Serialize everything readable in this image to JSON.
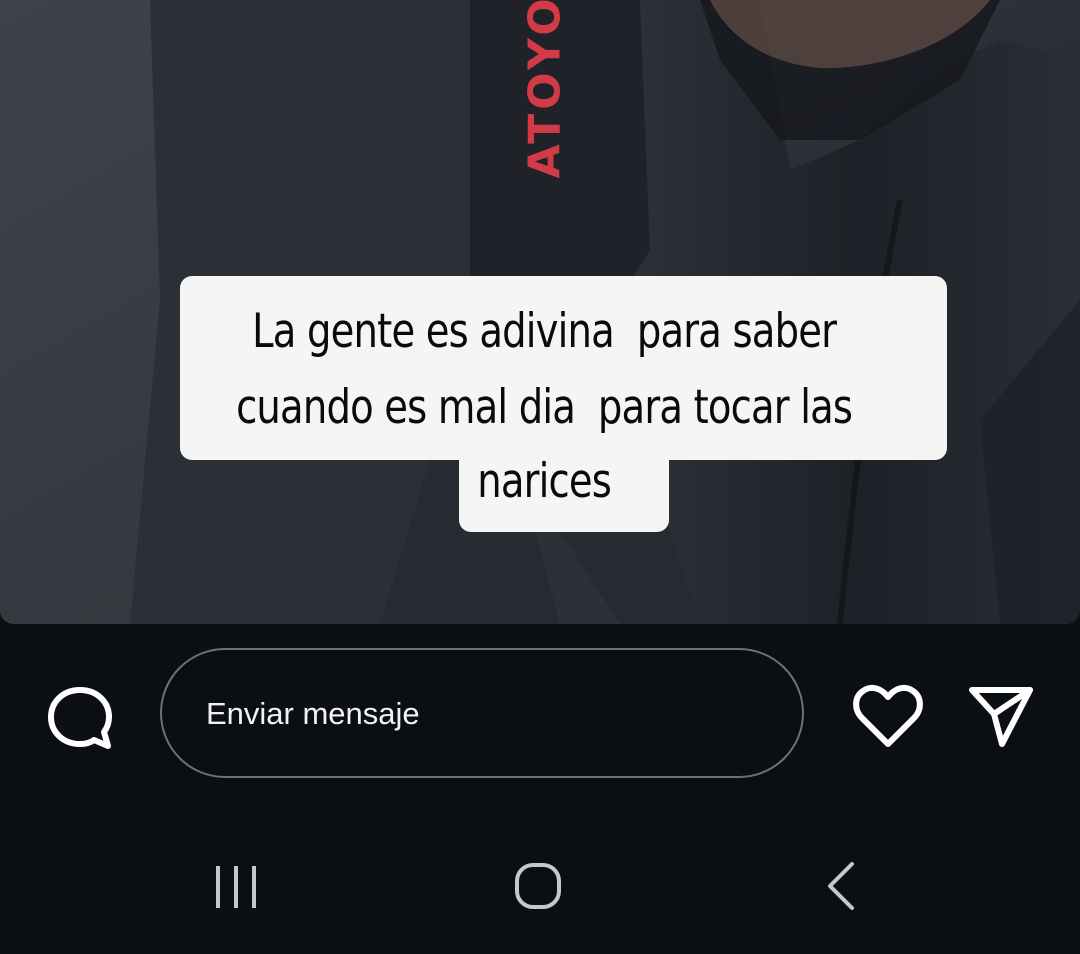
{
  "story": {
    "photo_description_icon": "person-in-dark-hoodie-photo",
    "brand_text": "ATOYO",
    "caption": {
      "line1": "La gente es adivina  para saber",
      "line2": "cuando es mal dia  para tocar las",
      "line3": "narices"
    }
  },
  "reply_bar": {
    "comment_icon": "speech-bubble-icon",
    "message_placeholder": "Enviar mensaje",
    "like_icon": "heart-icon",
    "share_icon": "paper-plane-icon"
  },
  "nav_bar": {
    "recents_icon": "recent-apps-icon",
    "home_icon": "home-icon",
    "back_icon": "back-chevron-icon"
  },
  "colors": {
    "background": "#0b0e13",
    "caption_bg": "#f5f5f5",
    "caption_text": "#0a0a0a",
    "brand_red": "#d23a45",
    "icon_white": "#ffffff",
    "input_border": "#6d7178",
    "nav_icon": "#c8c8c8"
  }
}
